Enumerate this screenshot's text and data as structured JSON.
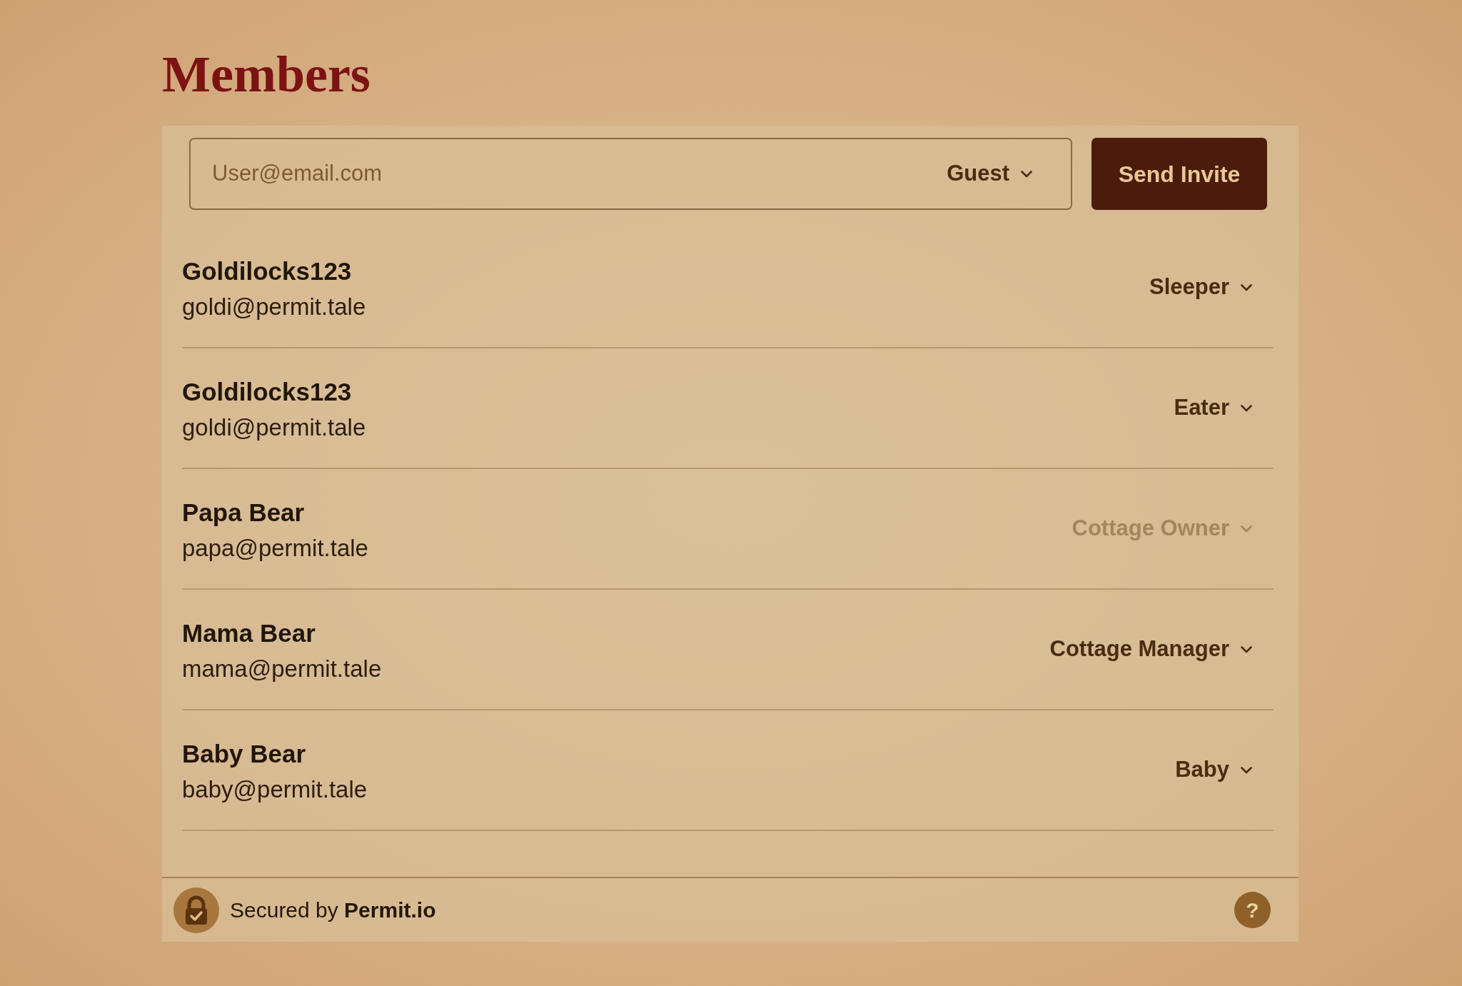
{
  "title": "Members",
  "invite": {
    "email": {
      "placeholder": "User@email.com"
    },
    "role": {
      "label": "Guest"
    },
    "button": "Send Invite"
  },
  "members": [
    {
      "name": "Goldilocks123",
      "email": "goldi@permit.tale",
      "role": "Sleeper",
      "disabled": false
    },
    {
      "name": "Goldilocks123",
      "email": "goldi@permit.tale",
      "role": "Eater",
      "disabled": false
    },
    {
      "name": "Papa Bear",
      "email": "papa@permit.tale",
      "role": "Cottage Owner",
      "disabled": true
    },
    {
      "name": "Mama Bear",
      "email": "mama@permit.tale",
      "role": "Cottage Manager",
      "disabled": false
    },
    {
      "name": "Baby Bear",
      "email": "baby@permit.tale",
      "role": "Baby",
      "disabled": false
    }
  ],
  "footer": {
    "text": "Secured by **Permit.io**",
    "help": "?"
  }
}
